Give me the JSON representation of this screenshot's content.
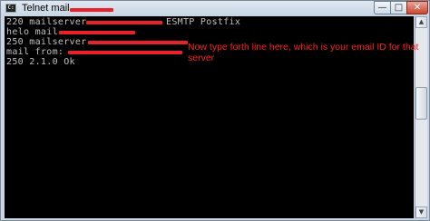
{
  "window": {
    "title": "Telnet mail",
    "icon": "console-icon",
    "controls": {
      "minimize": "—",
      "maximize": "□",
      "close": "✕"
    }
  },
  "console": {
    "lines": [
      "220 mailserver.",
      "ESMTP Postfix",
      "helo mail.",
      "250 mailserver.",
      "mail from: ",
      "250 2.1.0 Ok"
    ]
  },
  "annotation": {
    "text": "Now type forth line here, which is your email ID for that server",
    "color": "#ff2020"
  },
  "colors": {
    "redaction": "#e8212b",
    "console_bg": "#000000",
    "console_text": "#c0c0c0"
  }
}
